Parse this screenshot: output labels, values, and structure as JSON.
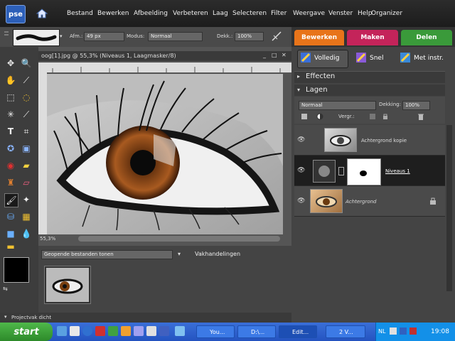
{
  "menu": {
    "logo_text": "pse",
    "items": [
      "Bestand",
      "Bewerken",
      "Afbeelding",
      "Verbeteren",
      "Laag",
      "Selecteren",
      "Filter",
      "Weergave",
      "Venster",
      "Help"
    ],
    "organizer_label": "Organizer"
  },
  "options": {
    "size_label": "Afm.:",
    "size_value": "49 px",
    "mode_label": "Modus:",
    "mode_value": "Normaal",
    "opacity_label": "Dekk.:",
    "opacity_value": "100%"
  },
  "document": {
    "title": "oog[1].jpg @ 55,3% (Niveaus 1, Laagmasker/8)",
    "zoom": "55,3%"
  },
  "bin": {
    "dropdown_label": "Geopende bestanden tonen",
    "tab_label": "Vakhandelingen"
  },
  "status": {
    "text": "Projectvak dicht"
  },
  "panel": {
    "tabs": [
      {
        "label": "Bewerken",
        "color": "#e8741a"
      },
      {
        "label": "Maken",
        "color": "#c4245a"
      },
      {
        "label": "Delen",
        "color": "#3a9a3a"
      }
    ],
    "modes": [
      "Volledig",
      "Snel",
      "Met instr."
    ],
    "sections": [
      "Effecten",
      "Lagen"
    ],
    "blend_mode": "Normaal",
    "opacity_label": "Dekking:",
    "opacity_value": "100%",
    "lock_label": "Vergr.:",
    "layers": [
      {
        "name": "Achtergrond kopie"
      },
      {
        "name": "Niveaus 1"
      },
      {
        "name": "Achtergrond"
      }
    ]
  },
  "taskbar": {
    "start_label": "start",
    "tasks": [
      "You...",
      "D:\\...",
      "Edit...",
      "2 V...",
      "NL"
    ],
    "clock": "19:08"
  }
}
